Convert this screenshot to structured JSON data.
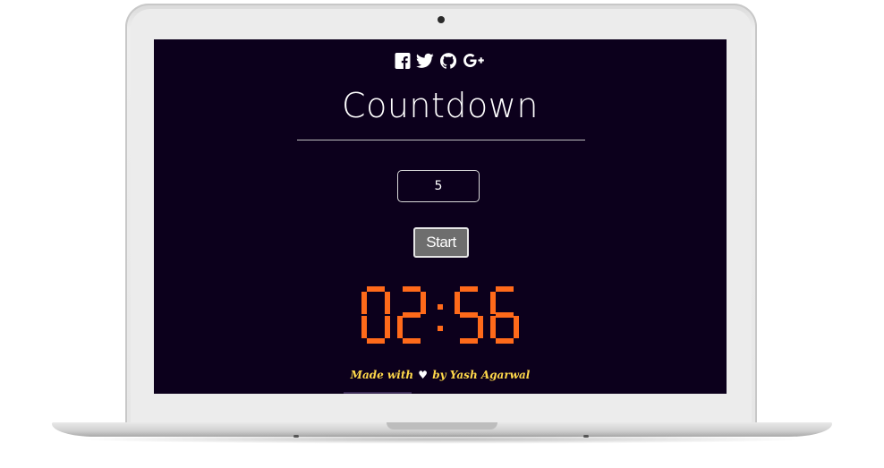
{
  "social": {
    "icons": [
      "facebook-icon",
      "twitter-icon",
      "github-icon",
      "google-plus-icon"
    ]
  },
  "header": {
    "title": "Countdown"
  },
  "form": {
    "minutes_value": "5",
    "start_label": "Start"
  },
  "timer": {
    "display": "02:56",
    "minutes": "02",
    "seconds": "56",
    "color": "#ff6a1a"
  },
  "footer": {
    "made_with": "Made with",
    "by": "by Yash Agarwal"
  },
  "colors": {
    "screen_background": "#0c001c",
    "accent": "#ff6a1a",
    "credit": "#ffd84a"
  }
}
